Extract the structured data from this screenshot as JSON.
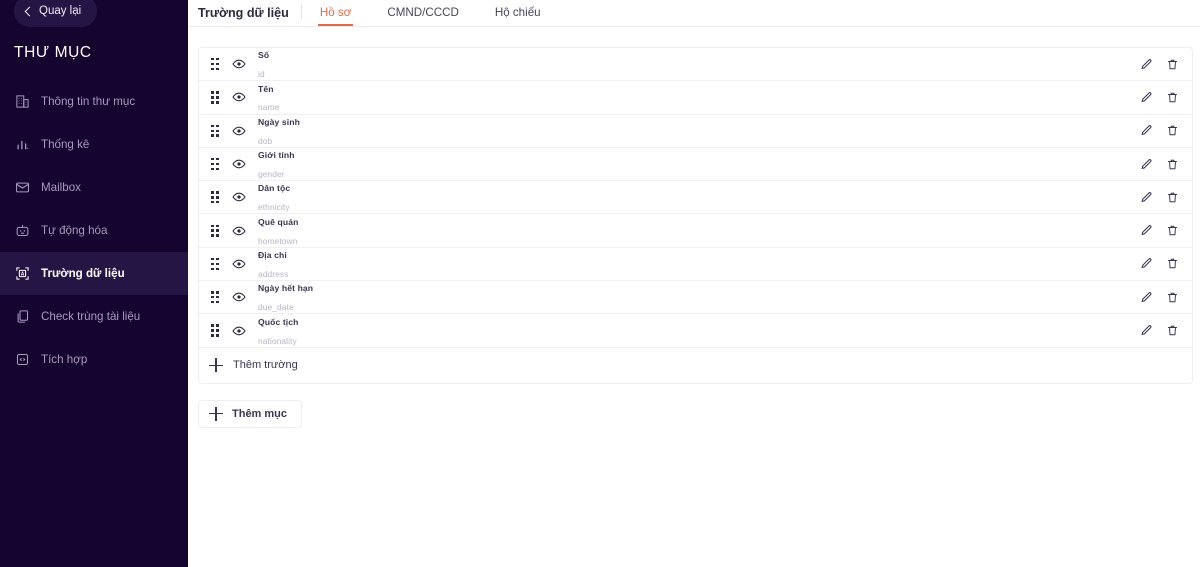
{
  "sidebar": {
    "back_button": {
      "label": "Quay lại",
      "icon": "chevron-left-icon"
    },
    "brand": "THƯ MỤC",
    "items": [
      {
        "label": "Thông tin thư mục",
        "icon": "building-icon",
        "active": false
      },
      {
        "label": "Thống kê",
        "icon": "bar-chart-icon",
        "active": false
      },
      {
        "label": "Mailbox",
        "icon": "mail-icon",
        "active": false
      },
      {
        "label": "Tự động hóa",
        "icon": "robot-icon",
        "active": false
      },
      {
        "label": "Trường dữ liệu",
        "icon": "data-field-icon",
        "active": true
      },
      {
        "label": "Check trùng tài liệu",
        "icon": "copy-icon",
        "active": false
      },
      {
        "label": "Tích hợp",
        "icon": "integration-icon",
        "active": false
      }
    ]
  },
  "header": {
    "title": "Trường dữ liệu",
    "tabs": [
      {
        "label": "Hồ sơ",
        "active": true
      },
      {
        "label": "CMND/CCCD",
        "active": false
      },
      {
        "label": "Hộ chiếu",
        "active": false
      }
    ]
  },
  "fields": [
    {
      "name": "Số",
      "key": "id"
    },
    {
      "name": "Tên",
      "key": "name"
    },
    {
      "name": "Ngày sinh",
      "key": "dob"
    },
    {
      "name": "Giới tính",
      "key": "gender"
    },
    {
      "name": "Dân tộc",
      "key": "ethnicity"
    },
    {
      "name": "Quê quán",
      "key": "hometown"
    },
    {
      "name": "Địa chỉ",
      "key": "address"
    },
    {
      "name": "Ngày hết hạn",
      "key": "due_date"
    },
    {
      "name": "Quốc tịch",
      "key": "nationality"
    }
  ],
  "row_icons": {
    "drag": "drag-handle-icon",
    "visibility": "eye-icon",
    "edit": "pencil-icon",
    "delete": "trash-icon"
  },
  "actions": {
    "add_field": {
      "label": "Thêm trường",
      "icon": "plus-icon"
    },
    "add_section": {
      "label": "Thêm mục",
      "icon": "plus-icon"
    }
  },
  "colors": {
    "sidebar_bg": "#160430",
    "sidebar_active_bg": "#241544",
    "accent": "#e06a4a",
    "text_primary": "#3b3550",
    "text_muted": "#b8b5c4",
    "border": "#eeeef2"
  }
}
